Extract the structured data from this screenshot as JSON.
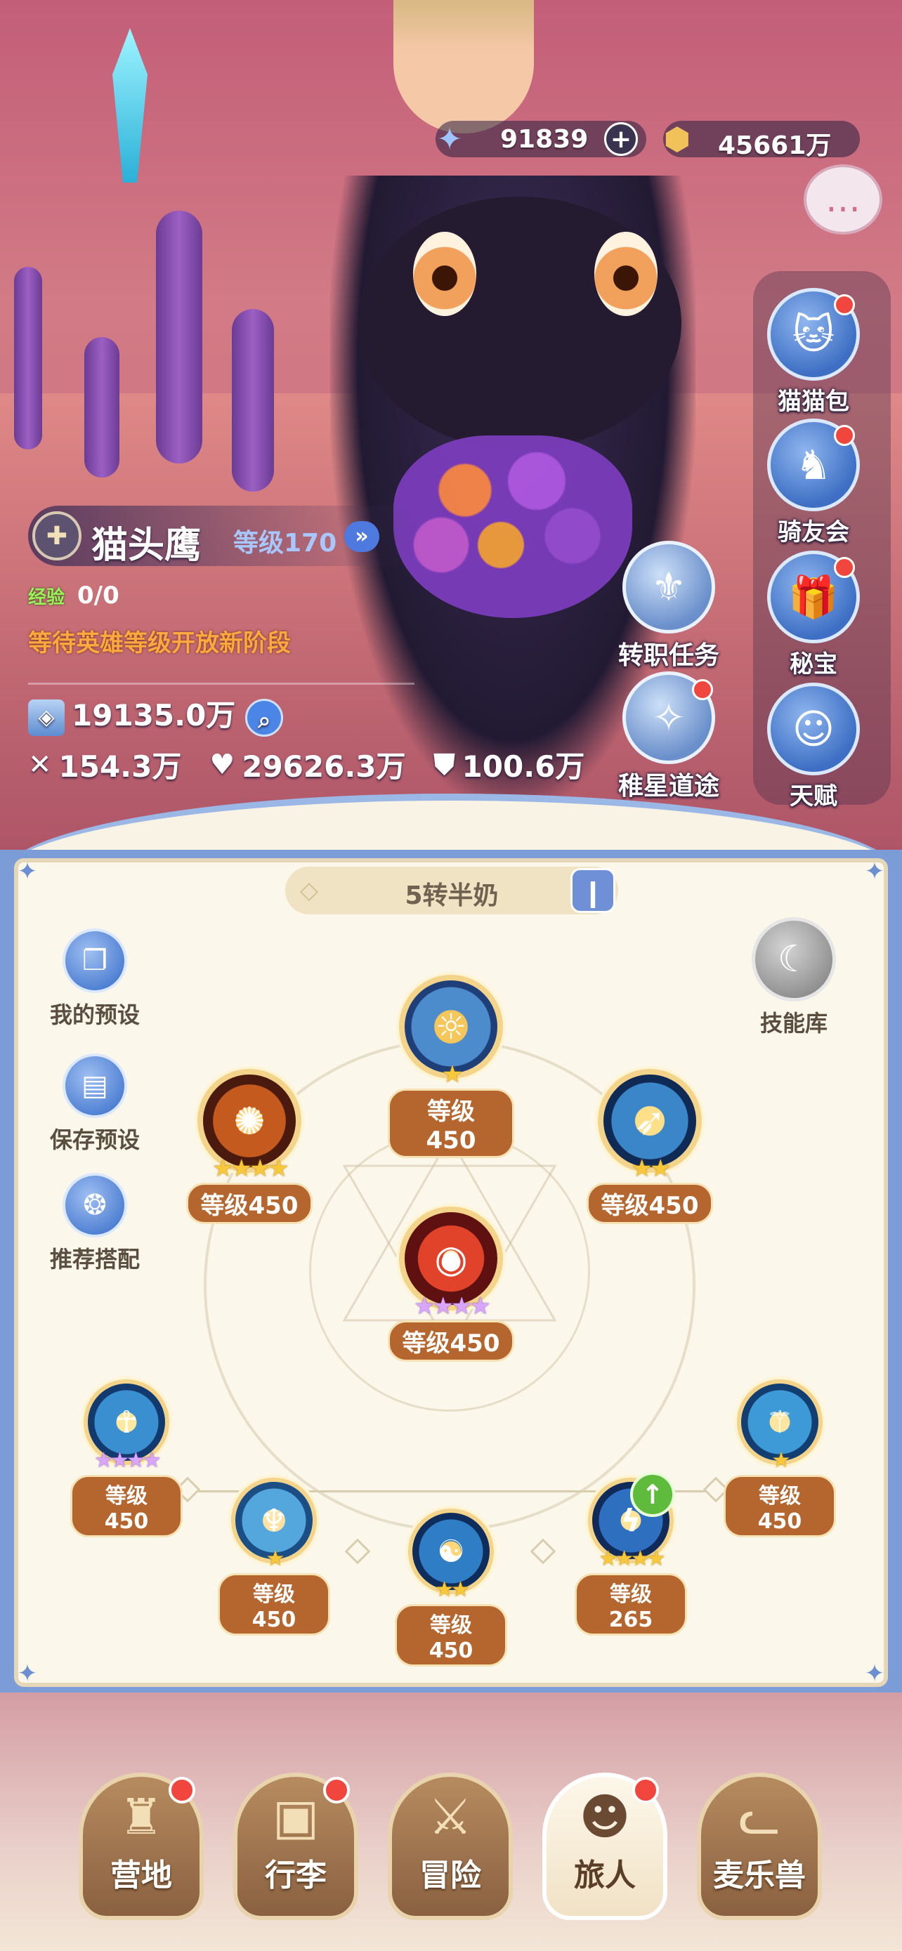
{
  "currency": {
    "gems": "91839",
    "coins": "45661万",
    "gem_icon": "star-gem-icon",
    "coin_icon": "coin-icon"
  },
  "side_menu": [
    {
      "label": "猫猫包",
      "icon": "cat-bag-icon",
      "dot": true
    },
    {
      "label": "骑友会",
      "icon": "horse-icon",
      "dot": true
    },
    {
      "label": "秘宝",
      "icon": "treasure-icon",
      "dot": true
    },
    {
      "label": "天赋",
      "icon": "talent-icon",
      "dot": false
    }
  ],
  "job_buttons": [
    {
      "label": "转职任务",
      "icon": "job-quest-icon",
      "dot": false
    },
    {
      "label": "稚星道途",
      "icon": "star-path-icon",
      "dot": true
    }
  ],
  "player": {
    "name": "猫头鹰",
    "level": "等级170",
    "exp_label": "经验",
    "exp": "0/0",
    "notice": "等待英雄等级开放新阶段",
    "power": "19135.0万",
    "attack": "154.3万",
    "hp": "29626.3万",
    "defense": "100.6万"
  },
  "skill_panel": {
    "preset_name": "5转半奶",
    "tools": [
      {
        "label": "我的预设",
        "icon": "preset-cards-icon"
      },
      {
        "label": "保存预设",
        "icon": "save-icon"
      },
      {
        "label": "推荐搭配",
        "icon": "recommend-icon"
      }
    ],
    "library_label": "技能库",
    "skills": [
      {
        "id": "top",
        "level": "等级450",
        "stars": 1,
        "star_color": "gold"
      },
      {
        "id": "upper-left",
        "level": "等级450",
        "stars": 4,
        "star_color": "gold"
      },
      {
        "id": "upper-right",
        "level": "等级450",
        "stars": 2,
        "star_color": "gold"
      },
      {
        "id": "center",
        "level": "等级450",
        "stars": 4,
        "star_color": "purple"
      },
      {
        "id": "far-left",
        "level": "等级450",
        "stars": 4,
        "star_color": "purple"
      },
      {
        "id": "mid-left",
        "level": "等级450",
        "stars": 1,
        "star_color": "gold"
      },
      {
        "id": "bottom-center",
        "level": "等级450",
        "stars": 2,
        "star_color": "gold"
      },
      {
        "id": "mid-right",
        "level": "等级265",
        "stars": 4,
        "star_color": "gold"
      },
      {
        "id": "far-right",
        "level": "等级450",
        "stars": 1,
        "star_color": "gold"
      }
    ]
  },
  "bottom_nav": [
    {
      "label": "营地",
      "icon": "castle-icon",
      "dot": true,
      "active": false
    },
    {
      "label": "行李",
      "icon": "backpack-icon",
      "dot": true,
      "active": false
    },
    {
      "label": "冒险",
      "icon": "crossed-swords-icon",
      "dot": false,
      "active": false
    },
    {
      "label": "旅人",
      "icon": "traveler-avatar-icon",
      "dot": true,
      "active": true
    },
    {
      "label": "麦乐兽",
      "icon": "cat-face-icon",
      "dot": false,
      "active": false
    }
  ],
  "colors": {
    "panel_border": "#7b9cd6",
    "panel_bg": "#fbf7ea",
    "level_badge": "#b5662f",
    "notice": "#ffa840",
    "red_dot": "#f0463d"
  }
}
